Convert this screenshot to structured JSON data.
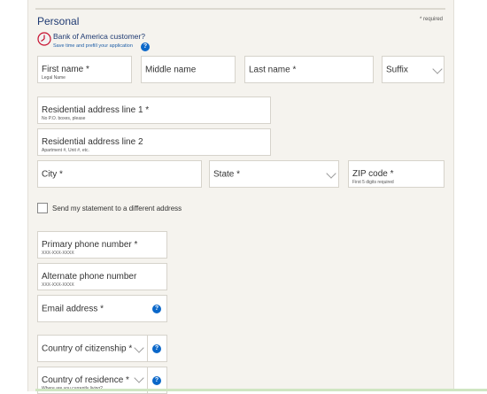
{
  "section": {
    "title": "Personal",
    "required_note": "* required"
  },
  "customer_prompt": {
    "title": "Bank of America customer?",
    "subtitle": "Save time and prefill your application",
    "help_icon": "?"
  },
  "fields": {
    "first_name": {
      "label": "First name *",
      "hint": "Legal Name"
    },
    "middle_name": {
      "label": "Middle name"
    },
    "last_name": {
      "label": "Last name *"
    },
    "suffix": {
      "label": "Suffix"
    },
    "address1": {
      "label": "Residential address line 1 *",
      "hint": "No P.O. boxes, please"
    },
    "address2": {
      "label": "Residential address line 2",
      "hint": "Apartment #, Unit #, etc."
    },
    "city": {
      "label": "City *"
    },
    "state": {
      "label": "State *"
    },
    "zip": {
      "label": "ZIP code *",
      "hint": "First 5 digits required"
    },
    "primary_phone": {
      "label": "Primary phone number *",
      "hint": "XXX-XXX-XXXX"
    },
    "alternate_phone": {
      "label": "Alternate phone number",
      "hint": "XXX-XXX-XXXX"
    },
    "email": {
      "label": "Email address *",
      "help_icon": "?"
    },
    "citizenship": {
      "label": "Country of citizenship *",
      "help_icon": "?"
    },
    "residence": {
      "label": "Country of residence *",
      "hint": "Where are you currently living?",
      "help_icon": "?"
    }
  },
  "statement_checkbox": {
    "label": "Send my statement to a different address",
    "checked": false
  },
  "colors": {
    "panel_bg": "#f5f3ee",
    "title": "#1f3a72",
    "link": "#1f5fa8",
    "help": "#0a67c9"
  },
  "icons": {
    "customer": "clock-icon",
    "help": "question-circle-icon",
    "dropdown": "chevron-down-icon"
  }
}
